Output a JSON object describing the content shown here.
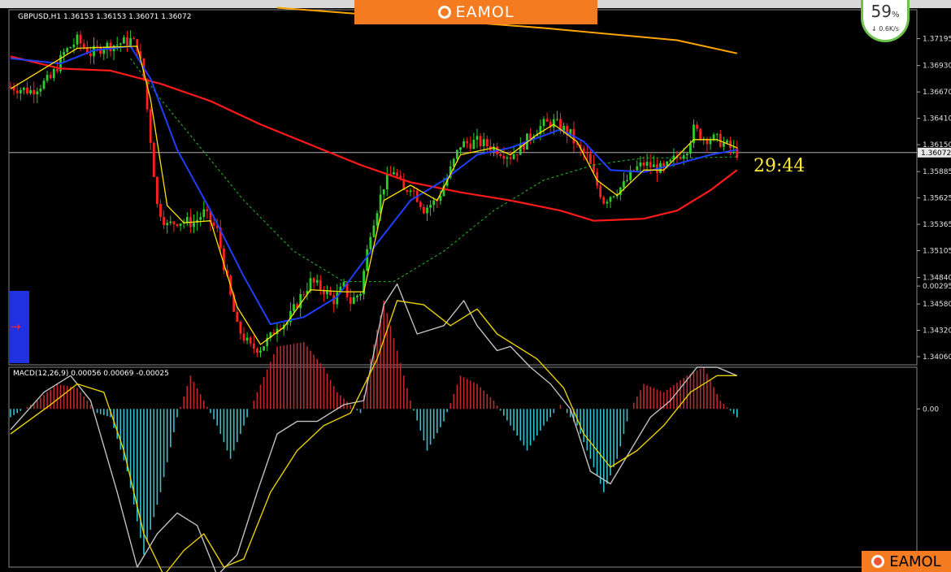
{
  "banner": {
    "brand": "EAMOL"
  },
  "corner_logo": {
    "brand": "EAMOL"
  },
  "gauge": {
    "percent": "59",
    "pct_sign": "%",
    "speed": "0.6K/s"
  },
  "countdown": "29:44",
  "nav": {
    "arrow": "→"
  },
  "chart_data": [
    {
      "type": "candlestick",
      "symbol_header": "GBPUSD,H1  1.36153 1.36153 1.36071 1.36072",
      "current_price": 1.36072,
      "current_price_label": "1.36072",
      "ylim": [
        1.3398,
        1.3748
      ],
      "yticks": [
        "1.37195",
        "1.36930",
        "1.36670",
        "1.36410",
        "1.36150",
        "1.35885",
        "1.35625",
        "1.35365",
        "1.35105",
        "1.34840",
        "1.34580",
        "1.34320",
        "1.34060"
      ],
      "colors": {
        "up": "#2ecc2e",
        "down": "#ff2020",
        "ma_fast": "#ffe000",
        "ma_mid": "#1f3fff",
        "ma_slow": "#ff1a1a",
        "ma_dotted": "#22bb22",
        "ma_long": "#ffa500",
        "price_line": "#b0b0b0"
      },
      "close_path": [
        [
          0,
          1.3672
        ],
        [
          6,
          1.3668
        ],
        [
          12,
          1.368
        ],
        [
          16,
          1.3705
        ],
        [
          20,
          1.3718
        ],
        [
          24,
          1.3705
        ],
        [
          28,
          1.3712
        ],
        [
          32,
          1.3714
        ],
        [
          36,
          1.3718
        ],
        [
          38,
          1.3712
        ],
        [
          40,
          1.368
        ],
        [
          42,
          1.362
        ],
        [
          44,
          1.3555
        ],
        [
          47,
          1.3535
        ],
        [
          50,
          1.354
        ],
        [
          55,
          1.3538
        ],
        [
          58,
          1.3548
        ],
        [
          62,
          1.353
        ],
        [
          65,
          1.348
        ],
        [
          68,
          1.3435
        ],
        [
          72,
          1.3415
        ],
        [
          75,
          1.3415
        ],
        [
          78,
          1.3425
        ],
        [
          80,
          1.3438
        ],
        [
          83,
          1.344
        ],
        [
          87,
          1.3465
        ],
        [
          90,
          1.348
        ],
        [
          94,
          1.3472
        ],
        [
          97,
          1.3462
        ],
        [
          100,
          1.3475
        ],
        [
          102,
          1.346
        ],
        [
          105,
          1.347
        ],
        [
          108,
          1.353
        ],
        [
          112,
          1.3575
        ],
        [
          115,
          1.359
        ],
        [
          118,
          1.3568
        ],
        [
          120,
          1.3575
        ],
        [
          124,
          1.3552
        ],
        [
          128,
          1.356
        ],
        [
          132,
          1.359
        ],
        [
          135,
          1.3615
        ],
        [
          140,
          1.3618
        ],
        [
          145,
          1.3612
        ],
        [
          150,
          1.3604
        ],
        [
          153,
          1.3612
        ],
        [
          157,
          1.3628
        ],
        [
          160,
          1.3635
        ],
        [
          163,
          1.3637
        ],
        [
          166,
          1.363
        ],
        [
          168,
          1.3625
        ],
        [
          170,
          1.3612
        ],
        [
          173,
          1.3603
        ],
        [
          176,
          1.3575
        ],
        [
          178,
          1.356
        ],
        [
          181,
          1.3568
        ],
        [
          184,
          1.3575
        ],
        [
          187,
          1.359
        ],
        [
          190,
          1.3596
        ],
        [
          193,
          1.3593
        ],
        [
          196,
          1.359
        ],
        [
          199,
          1.36
        ],
        [
          203,
          1.3612
        ],
        [
          205,
          1.363
        ],
        [
          208,
          1.3622
        ],
        [
          212,
          1.362
        ],
        [
          215,
          1.3614
        ],
        [
          218,
          1.3607
        ]
      ],
      "ma_fast": [
        [
          0,
          1.367
        ],
        [
          20,
          1.371
        ],
        [
          38,
          1.3712
        ],
        [
          42,
          1.366
        ],
        [
          47,
          1.3555
        ],
        [
          52,
          1.3538
        ],
        [
          60,
          1.354
        ],
        [
          68,
          1.3455
        ],
        [
          75,
          1.3418
        ],
        [
          82,
          1.3435
        ],
        [
          90,
          1.3472
        ],
        [
          100,
          1.347
        ],
        [
          106,
          1.347
        ],
        [
          112,
          1.356
        ],
        [
          120,
          1.3575
        ],
        [
          128,
          1.356
        ],
        [
          135,
          1.3605
        ],
        [
          145,
          1.3612
        ],
        [
          150,
          1.3605
        ],
        [
          158,
          1.3625
        ],
        [
          163,
          1.3635
        ],
        [
          170,
          1.3618
        ],
        [
          176,
          1.358
        ],
        [
          182,
          1.3565
        ],
        [
          190,
          1.359
        ],
        [
          196,
          1.359
        ],
        [
          205,
          1.362
        ],
        [
          212,
          1.362
        ],
        [
          218,
          1.3612
        ]
      ],
      "ma_mid": [
        [
          0,
          1.37
        ],
        [
          15,
          1.3695
        ],
        [
          25,
          1.3708
        ],
        [
          36,
          1.3712
        ],
        [
          42,
          1.368
        ],
        [
          50,
          1.361
        ],
        [
          60,
          1.355
        ],
        [
          70,
          1.3485
        ],
        [
          78,
          1.3438
        ],
        [
          88,
          1.3445
        ],
        [
          98,
          1.3465
        ],
        [
          110,
          1.3518
        ],
        [
          120,
          1.356
        ],
        [
          130,
          1.358
        ],
        [
          140,
          1.3605
        ],
        [
          150,
          1.3612
        ],
        [
          165,
          1.363
        ],
        [
          172,
          1.3618
        ],
        [
          180,
          1.359
        ],
        [
          190,
          1.3588
        ],
        [
          200,
          1.3596
        ],
        [
          210,
          1.3605
        ],
        [
          218,
          1.361
        ]
      ],
      "ma_slow": [
        [
          0,
          1.3702
        ],
        [
          15,
          1.369
        ],
        [
          30,
          1.3688
        ],
        [
          45,
          1.3675
        ],
        [
          60,
          1.3658
        ],
        [
          75,
          1.3635
        ],
        [
          90,
          1.3615
        ],
        [
          105,
          1.3595
        ],
        [
          120,
          1.3578
        ],
        [
          135,
          1.3568
        ],
        [
          150,
          1.356
        ],
        [
          165,
          1.355
        ],
        [
          175,
          1.354
        ],
        [
          190,
          1.3542
        ],
        [
          200,
          1.355
        ],
        [
          210,
          1.357
        ],
        [
          218,
          1.359
        ]
      ],
      "ma_dotted": [
        [
          36,
          1.37
        ],
        [
          45,
          1.366
        ],
        [
          55,
          1.362
        ],
        [
          70,
          1.356
        ],
        [
          85,
          1.351
        ],
        [
          100,
          1.348
        ],
        [
          115,
          1.348
        ],
        [
          130,
          1.351
        ],
        [
          145,
          1.355
        ],
        [
          160,
          1.358
        ],
        [
          175,
          1.3595
        ],
        [
          190,
          1.3602
        ],
        [
          205,
          1.3602
        ],
        [
          218,
          1.3603
        ]
      ],
      "ma_long": [
        [
          80,
          1.375
        ],
        [
          120,
          1.374
        ],
        [
          160,
          1.373
        ],
        [
          200,
          1.3718
        ],
        [
          218,
          1.3705
        ]
      ]
    },
    {
      "type": "macd",
      "label": "MACD(12,26,9) 0.00056 0.00069 -0.00025",
      "ylim": [
        -0.0038,
        0.001
      ],
      "yticks": [
        "0.00295",
        "0.00"
      ],
      "tick_values": [
        0.00295,
        0.0
      ],
      "colors": {
        "hist_pos": "#c0282e",
        "hist_neg": "#30c4d0",
        "main": "#c0c0c0",
        "signal": "#e8d000"
      },
      "hist": [
        [
          0,
          -0.0002
        ],
        [
          8,
          0.0002
        ],
        [
          14,
          0.0006
        ],
        [
          20,
          0.0005
        ],
        [
          26,
          -0.0001
        ],
        [
          30,
          -0.0002
        ],
        [
          35,
          -0.0015
        ],
        [
          40,
          -0.0035
        ],
        [
          45,
          -0.002
        ],
        [
          50,
          -0.0002
        ],
        [
          54,
          0.0008
        ],
        [
          58,
          0.0002
        ],
        [
          62,
          -0.0004
        ],
        [
          66,
          -0.0012
        ],
        [
          70,
          -0.0004
        ],
        [
          74,
          0.0004
        ],
        [
          80,
          0.0015
        ],
        [
          88,
          0.0016
        ],
        [
          94,
          0.001
        ],
        [
          98,
          0.0004
        ],
        [
          102,
          0.0001
        ],
        [
          105,
          -0.0001
        ],
        [
          108,
          0.0012
        ],
        [
          112,
          0.0026
        ],
        [
          116,
          0.0014
        ],
        [
          120,
          0.0002
        ],
        [
          125,
          -0.001
        ],
        [
          130,
          -0.0003
        ],
        [
          135,
          0.0008
        ],
        [
          140,
          0.0006
        ],
        [
          145,
          0.0002
        ],
        [
          150,
          -0.0004
        ],
        [
          155,
          -0.001
        ],
        [
          160,
          -0.0004
        ],
        [
          165,
          0.0001
        ],
        [
          170,
          -0.0004
        ],
        [
          175,
          -0.0014
        ],
        [
          178,
          -0.002
        ],
        [
          182,
          -0.0012
        ],
        [
          186,
          0.0
        ],
        [
          190,
          0.0006
        ],
        [
          196,
          0.0004
        ],
        [
          203,
          0.0008
        ],
        [
          208,
          0.001
        ],
        [
          213,
          0.0002
        ],
        [
          218,
          -0.0002
        ]
      ],
      "main": [
        [
          0,
          -0.0005
        ],
        [
          10,
          0.0004
        ],
        [
          18,
          0.0008
        ],
        [
          24,
          0.0002
        ],
        [
          32,
          -0.002
        ],
        [
          38,
          -0.0038
        ],
        [
          44,
          -0.003
        ],
        [
          50,
          -0.0025
        ],
        [
          56,
          -0.0028
        ],
        [
          62,
          -0.004
        ],
        [
          68,
          -0.0035
        ],
        [
          74,
          -0.002
        ],
        [
          80,
          -0.0006
        ],
        [
          86,
          -0.0003
        ],
        [
          92,
          -0.0003
        ],
        [
          100,
          0.0001
        ],
        [
          106,
          0.0002
        ],
        [
          112,
          0.0025
        ],
        [
          116,
          0.003
        ],
        [
          122,
          0.0018
        ],
        [
          130,
          0.002
        ],
        [
          136,
          0.0026
        ],
        [
          140,
          0.002
        ],
        [
          146,
          0.0014
        ],
        [
          150,
          0.0015
        ],
        [
          156,
          0.001
        ],
        [
          162,
          0.0006
        ],
        [
          168,
          0.0
        ],
        [
          174,
          -0.0015
        ],
        [
          180,
          -0.0018
        ],
        [
          186,
          -0.001
        ],
        [
          192,
          -0.0002
        ],
        [
          198,
          0.0002
        ],
        [
          206,
          0.001
        ],
        [
          212,
          0.001
        ],
        [
          218,
          0.0008
        ]
      ],
      "signal": [
        [
          0,
          -0.0006
        ],
        [
          12,
          0.0001
        ],
        [
          20,
          0.0006
        ],
        [
          28,
          0.0004
        ],
        [
          34,
          -0.001
        ],
        [
          40,
          -0.003
        ],
        [
          46,
          -0.004
        ],
        [
          52,
          -0.0034
        ],
        [
          58,
          -0.003
        ],
        [
          64,
          -0.0038
        ],
        [
          70,
          -0.0036
        ],
        [
          78,
          -0.002
        ],
        [
          86,
          -0.001
        ],
        [
          94,
          -0.0004
        ],
        [
          102,
          -0.0001
        ],
        [
          110,
          0.0012
        ],
        [
          116,
          0.0026
        ],
        [
          124,
          0.0025
        ],
        [
          132,
          0.002
        ],
        [
          140,
          0.0024
        ],
        [
          146,
          0.0018
        ],
        [
          152,
          0.0015
        ],
        [
          158,
          0.0012
        ],
        [
          166,
          0.0005
        ],
        [
          172,
          -0.0006
        ],
        [
          180,
          -0.0014
        ],
        [
          188,
          -0.001
        ],
        [
          196,
          -0.0004
        ],
        [
          204,
          0.0004
        ],
        [
          212,
          0.0008
        ],
        [
          218,
          0.0008
        ]
      ]
    }
  ]
}
